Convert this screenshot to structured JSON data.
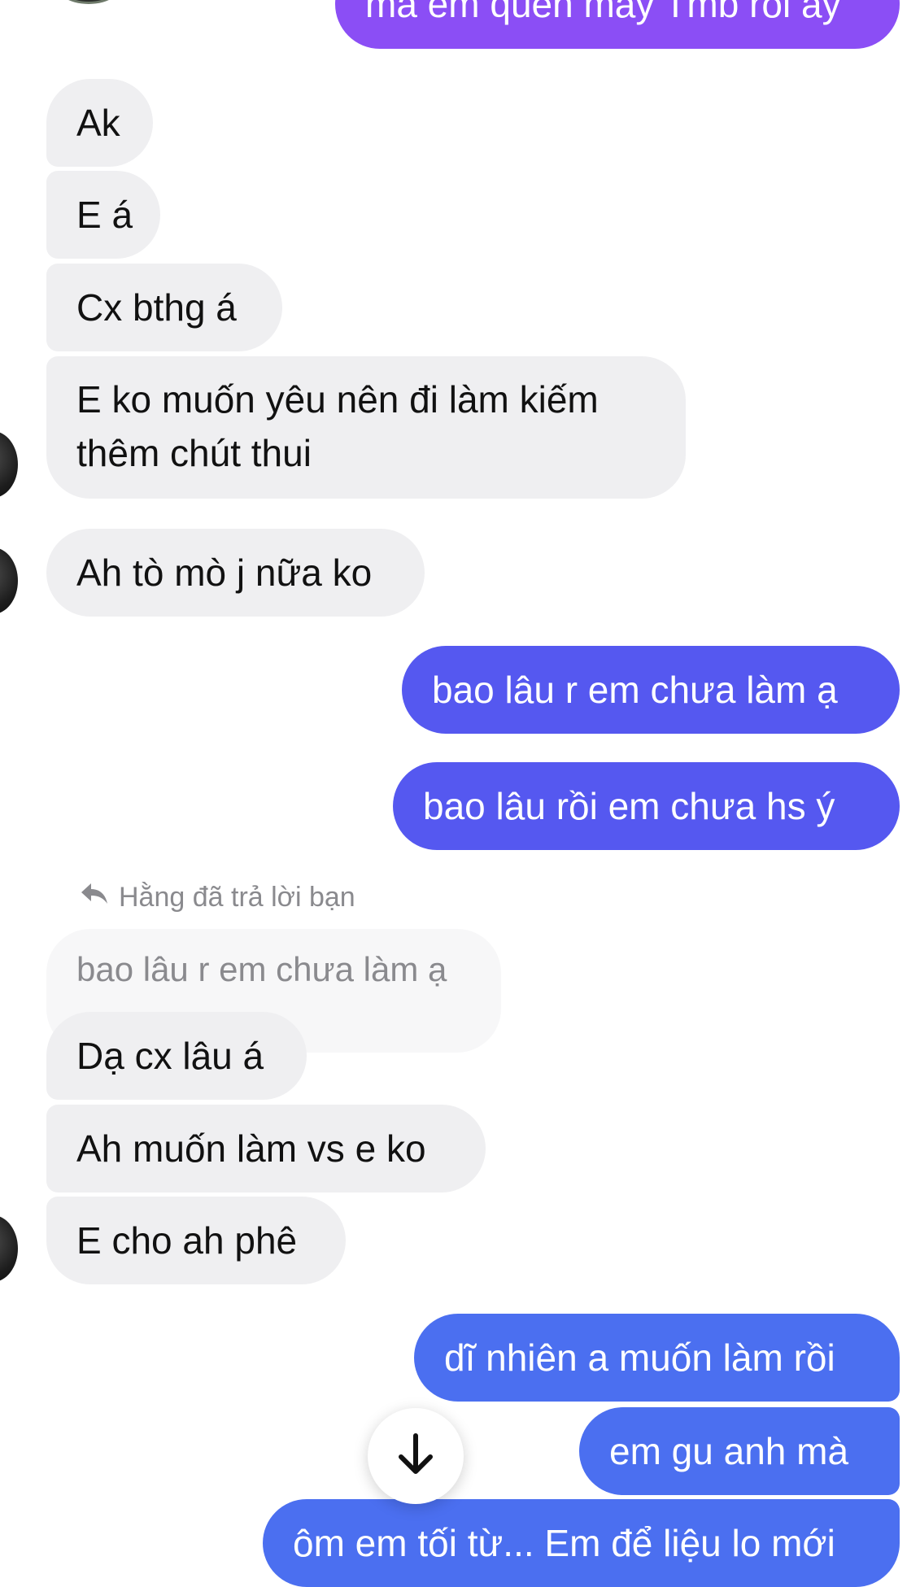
{
  "colors": {
    "incoming_bubble": "#efeff1",
    "outgoing_violet": "#8b4ef5",
    "outgoing_indigo": "#5558f0",
    "outgoing_blue": "#4b6ff0",
    "quoted_bubble": "#f7f7f8",
    "meta_text": "#8a8a8e"
  },
  "messages": {
    "top_outgoing_partial": "mà em quên mấy Tmb rồi ấy",
    "m1": "Ak",
    "m2": "E á",
    "m3": "Cx bthg á",
    "m4_line1": "E ko muốn yêu nên đi làm kiếm",
    "m4_line2": "thêm chút thui",
    "m5": "Ah tò mò j nữa ko",
    "m6": "bao lâu r em chưa làm ạ",
    "m7": "bao lâu rồi em chưa hs ý",
    "reply_label": "Hằng đã trả lời bạn",
    "quoted": "bao lâu r em chưa làm ạ",
    "m8": "Dạ cx lâu á",
    "m9": "Ah muốn làm vs e ko",
    "m10": "E cho ah phê",
    "m11": "dĩ nhiên a muốn làm rồi",
    "m12": "em gu anh mà",
    "m13_partial": "ôm em tối từ... Em để liệu lo mới"
  },
  "icons": {
    "reply": "reply-arrow-icon",
    "scroll_down": "arrow-down-icon"
  }
}
